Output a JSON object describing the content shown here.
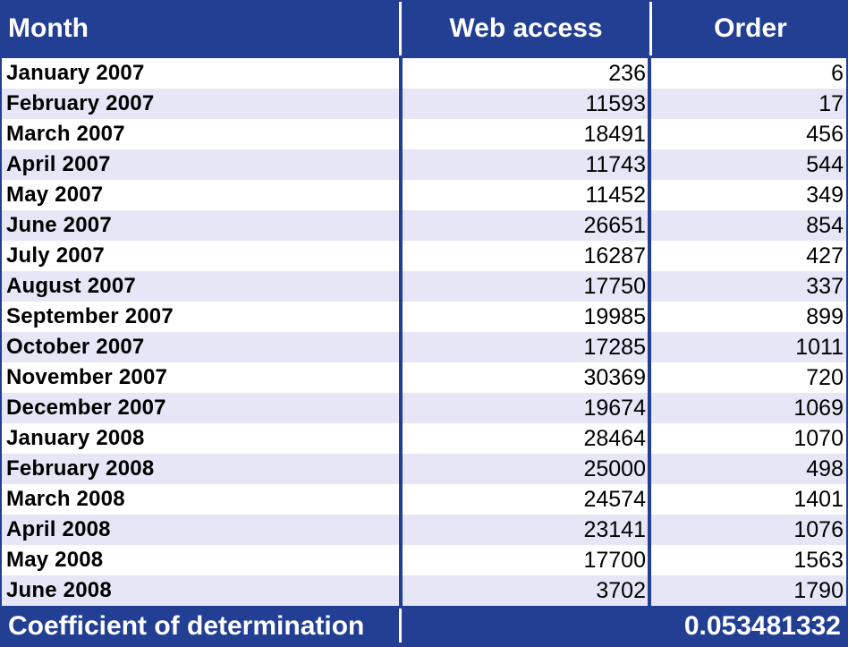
{
  "table": {
    "headers": {
      "month": "Month",
      "web_access": "Web access",
      "order": "Order"
    },
    "rows": [
      {
        "month": "January 2007",
        "web_access": "236",
        "order": "6"
      },
      {
        "month": "February 2007",
        "web_access": "11593",
        "order": "17"
      },
      {
        "month": "March 2007",
        "web_access": "18491",
        "order": "456"
      },
      {
        "month": "April 2007",
        "web_access": "11743",
        "order": "544"
      },
      {
        "month": "May 2007",
        "web_access": "11452",
        "order": "349"
      },
      {
        "month": "June 2007",
        "web_access": "26651",
        "order": "854"
      },
      {
        "month": "July 2007",
        "web_access": "16287",
        "order": "427"
      },
      {
        "month": "August 2007",
        "web_access": "17750",
        "order": "337"
      },
      {
        "month": "September 2007",
        "web_access": "19985",
        "order": "899"
      },
      {
        "month": "October 2007",
        "web_access": "17285",
        "order": "1011"
      },
      {
        "month": "November 2007",
        "web_access": "30369",
        "order": "720"
      },
      {
        "month": "December 2007",
        "web_access": "19674",
        "order": "1069"
      },
      {
        "month": "January 2008",
        "web_access": "28464",
        "order": "1070"
      },
      {
        "month": "February 2008",
        "web_access": "25000",
        "order": "498"
      },
      {
        "month": "March 2008",
        "web_access": "24574",
        "order": "1401"
      },
      {
        "month": "April 2008",
        "web_access": "23141",
        "order": "1076"
      },
      {
        "month": "May 2008",
        "web_access": "17700",
        "order": "1563"
      },
      {
        "month": "June 2008",
        "web_access": "3702",
        "order": "1790"
      }
    ],
    "footer": {
      "label": "Coefficient of determination",
      "value": "0.053481332"
    }
  },
  "colors": {
    "header_bg": "#223f94",
    "header_text": "#ffffff",
    "row_bg": "#ffffff",
    "row_alt_bg": "#e6e6f6"
  }
}
